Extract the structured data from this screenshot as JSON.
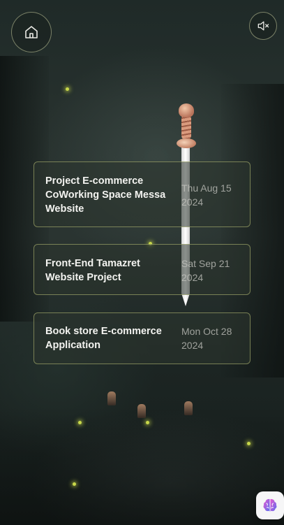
{
  "header": {
    "home_icon": "home-icon",
    "mute_icon": "speaker-muted-icon"
  },
  "projects": [
    {
      "title": "Project E-commerce CoWorking Space Messa Website",
      "date": "Thu Aug 15 2024"
    },
    {
      "title": "Front-End Tamazret Website Project",
      "date": "Sat Sep 21 2024"
    },
    {
      "title": "Book store E-commerce Application",
      "date": "Mon Oct 28 2024"
    }
  ],
  "assistant_button": {
    "icon": "brain-icon"
  },
  "colors": {
    "card_border": "#bec378",
    "text_primary": "#f3f3f0",
    "text_muted": "#c8c8c3",
    "firefly": "#c8d84a",
    "brain_pink": "#e85ad0",
    "brain_blue": "#5a6cf0"
  }
}
